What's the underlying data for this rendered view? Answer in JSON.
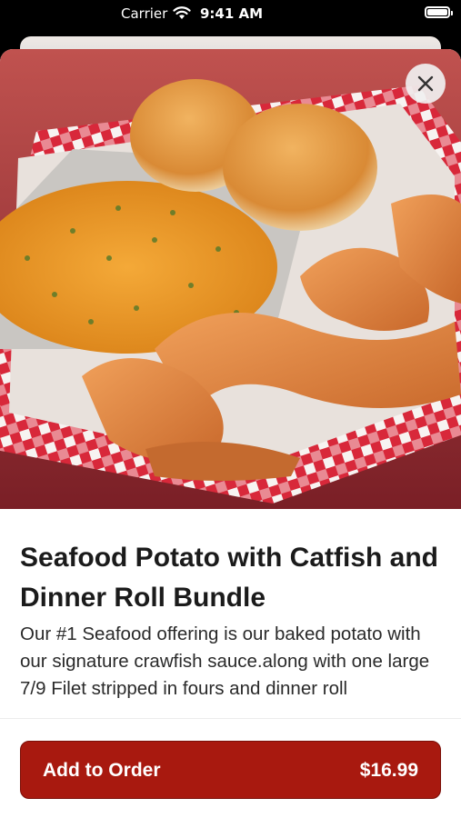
{
  "status_bar": {
    "carrier": "Carrier",
    "time": "9:41 AM"
  },
  "product": {
    "image_icon": "seafood-basket-photo",
    "title": "Seafood Potato with Catfish and Dinner Roll Bundle",
    "description": "Our #1 Seafood offering is our baked potato with our signature crawfish sauce.along with one large 7/9 Filet stripped in fours and dinner roll"
  },
  "close_icon": "close-icon",
  "order_button": {
    "label": "Add to Order",
    "price": "$16.99",
    "color": "#a8190f"
  }
}
